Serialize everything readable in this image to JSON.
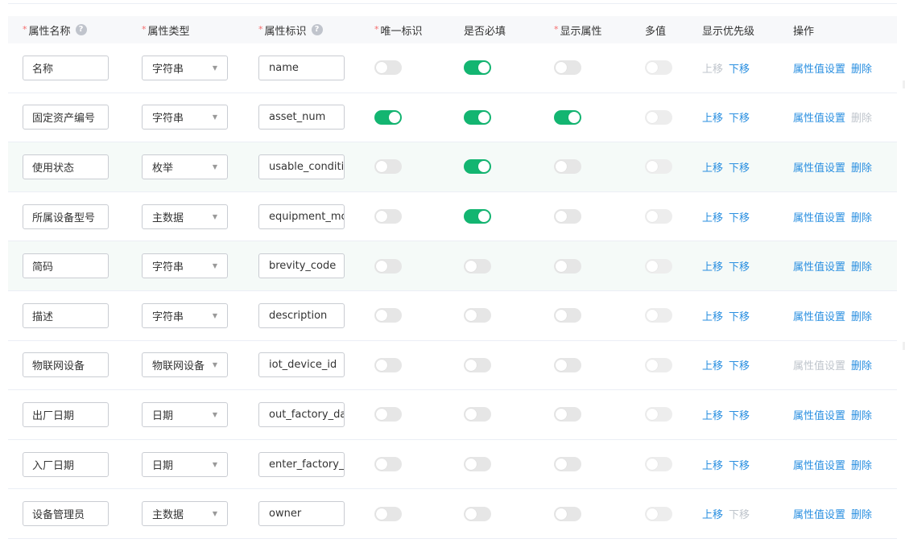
{
  "header": {
    "name": "属性名称",
    "type": "属性类型",
    "key": "属性标识",
    "unique": "唯一标识",
    "required": "是否必填",
    "display": "显示属性",
    "multi": "多值",
    "order": "显示优先级",
    "ops": "操作"
  },
  "actions": {
    "up": "上移",
    "down": "下移",
    "settings": "属性值设置",
    "delete": "删除"
  },
  "rows": [
    {
      "name": "名称",
      "type": "字符串",
      "key": "name",
      "unique": false,
      "required": true,
      "display": false,
      "multi": false,
      "up_enabled": false,
      "down_enabled": true,
      "settings_enabled": true,
      "delete_enabled": true
    },
    {
      "name": "固定资产编号",
      "type": "字符串",
      "key": "asset_num",
      "unique": true,
      "required": true,
      "display": true,
      "multi": false,
      "up_enabled": true,
      "down_enabled": true,
      "settings_enabled": true,
      "delete_enabled": false
    },
    {
      "name": "使用状态",
      "type": "枚举",
      "key": "usable_conditi",
      "unique": false,
      "required": true,
      "display": false,
      "multi": false,
      "up_enabled": true,
      "down_enabled": true,
      "settings_enabled": true,
      "delete_enabled": true
    },
    {
      "name": "所属设备型号",
      "type": "主数据",
      "key": "equipment_mc",
      "unique": false,
      "required": true,
      "display": false,
      "multi": false,
      "up_enabled": true,
      "down_enabled": true,
      "settings_enabled": true,
      "delete_enabled": true
    },
    {
      "name": "简码",
      "type": "字符串",
      "key": "brevity_code",
      "unique": false,
      "required": false,
      "display": false,
      "multi": false,
      "up_enabled": true,
      "down_enabled": true,
      "settings_enabled": true,
      "delete_enabled": true
    },
    {
      "name": "描述",
      "type": "字符串",
      "key": "description",
      "unique": false,
      "required": false,
      "display": false,
      "multi": false,
      "up_enabled": true,
      "down_enabled": true,
      "settings_enabled": true,
      "delete_enabled": true
    },
    {
      "name": "物联网设备",
      "type": "物联网设备",
      "key": "iot_device_id",
      "unique": false,
      "required": false,
      "display": false,
      "multi": false,
      "up_enabled": true,
      "down_enabled": true,
      "settings_enabled": false,
      "delete_enabled": true
    },
    {
      "name": "出厂日期",
      "type": "日期",
      "key": "out_factory_da",
      "unique": false,
      "required": false,
      "display": false,
      "multi": false,
      "up_enabled": true,
      "down_enabled": true,
      "settings_enabled": true,
      "delete_enabled": true
    },
    {
      "name": "入厂日期",
      "type": "日期",
      "key": "enter_factory_",
      "unique": false,
      "required": false,
      "display": false,
      "multi": false,
      "up_enabled": true,
      "down_enabled": true,
      "settings_enabled": true,
      "delete_enabled": true
    },
    {
      "name": "设备管理员",
      "type": "主数据",
      "key": "owner",
      "unique": false,
      "required": false,
      "display": false,
      "multi": false,
      "up_enabled": true,
      "down_enabled": false,
      "settings_enabled": true,
      "delete_enabled": true
    }
  ]
}
